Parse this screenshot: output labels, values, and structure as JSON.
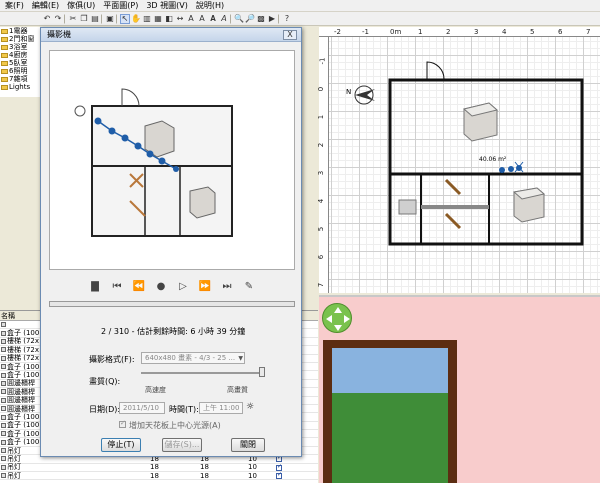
{
  "menubar": {
    "items": [
      "案(F)",
      "編輯(E)",
      "傢俱(U)",
      "平面圖(P)",
      "3D 視圖(V)",
      "說明(H)"
    ]
  },
  "tree": {
    "items": [
      "1電器",
      "2門和窗",
      "3浴室",
      "4廚房",
      "5臥室",
      "6照明",
      "7雜項",
      "Lights"
    ]
  },
  "table": {
    "header": "名稱",
    "rows": [
      {
        "name": "",
        "w": "",
        "d": "",
        "h": ""
      },
      {
        "name": "盒子 (100",
        "w": "",
        "d": "",
        "h": ""
      },
      {
        "name": "樓梯 (72x",
        "w": "",
        "d": "",
        "h": ""
      },
      {
        "name": "樓梯 (72x",
        "w": "",
        "d": "",
        "h": ""
      },
      {
        "name": "樓梯 (72x",
        "w": "",
        "d": "",
        "h": ""
      },
      {
        "name": "盒子 (100",
        "w": "",
        "d": "",
        "h": ""
      },
      {
        "name": "盒子 (100",
        "w": "",
        "d": "",
        "h": ""
      },
      {
        "name": "圓邊櫃桿",
        "w": "",
        "d": "",
        "h": ""
      },
      {
        "name": "圓邊櫃桿",
        "w": "",
        "d": "",
        "h": ""
      },
      {
        "name": "圓邊櫃桿",
        "w": "",
        "d": "",
        "h": ""
      },
      {
        "name": "圓邊櫃桿",
        "w": "",
        "d": "",
        "h": ""
      },
      {
        "name": "盒子 (100",
        "w": "",
        "d": "",
        "h": ""
      },
      {
        "name": "盒子 (100",
        "w": "",
        "d": "",
        "h": ""
      },
      {
        "name": "盒子 (100",
        "w": "",
        "d": "",
        "h": ""
      },
      {
        "name": "盒子 (100",
        "w": "",
        "d": "",
        "h": ""
      },
      {
        "name": "吊灯",
        "w": "18",
        "d": "18",
        "h": "10"
      },
      {
        "name": "吊灯",
        "w": "18",
        "d": "18",
        "h": "10"
      },
      {
        "name": "吊灯",
        "w": "18",
        "d": "18",
        "h": "10"
      },
      {
        "name": "吊灯",
        "w": "18",
        "d": "18",
        "h": "10"
      }
    ]
  },
  "dialog": {
    "title": "攝影機",
    "close": "X",
    "status": "2 / 310 - 估計剩餘時間: 6 小時 39 分鐘",
    "format_label": "攝影格式(F):",
    "format_value": "640x480 畫素 - 4/3 - 25 ...",
    "quality_label": "畫質(Q):",
    "quality_low": "高速度",
    "quality_high": "高畫質",
    "date_label": "日期(D):",
    "date_value": "2011/5/10",
    "time_label": "時間(T):",
    "time_value": "上午 11:00",
    "ceiling_label": "增加天花板上中心光源(A)",
    "stop": "停止(T)",
    "save": "儲存(S)...",
    "close_btn": "關閉"
  },
  "plan": {
    "ruler_top": [
      "-2",
      "-1",
      "0m",
      "1",
      "2",
      "3",
      "4",
      "5",
      "6",
      "7",
      "8",
      "9"
    ],
    "ruler_left": [
      "-1",
      "0",
      "1",
      "2",
      "3",
      "4",
      "5",
      "6",
      "7",
      "8"
    ],
    "area_label": "40.06 m²",
    "compass": "N"
  },
  "colors": {
    "wall": "#1a1a1a",
    "camera_path": "#1f5da8",
    "sky": "#89b3df",
    "grass": "#3f8d38",
    "frame": "#5c2d12",
    "view_bg": "#f8cccc"
  }
}
